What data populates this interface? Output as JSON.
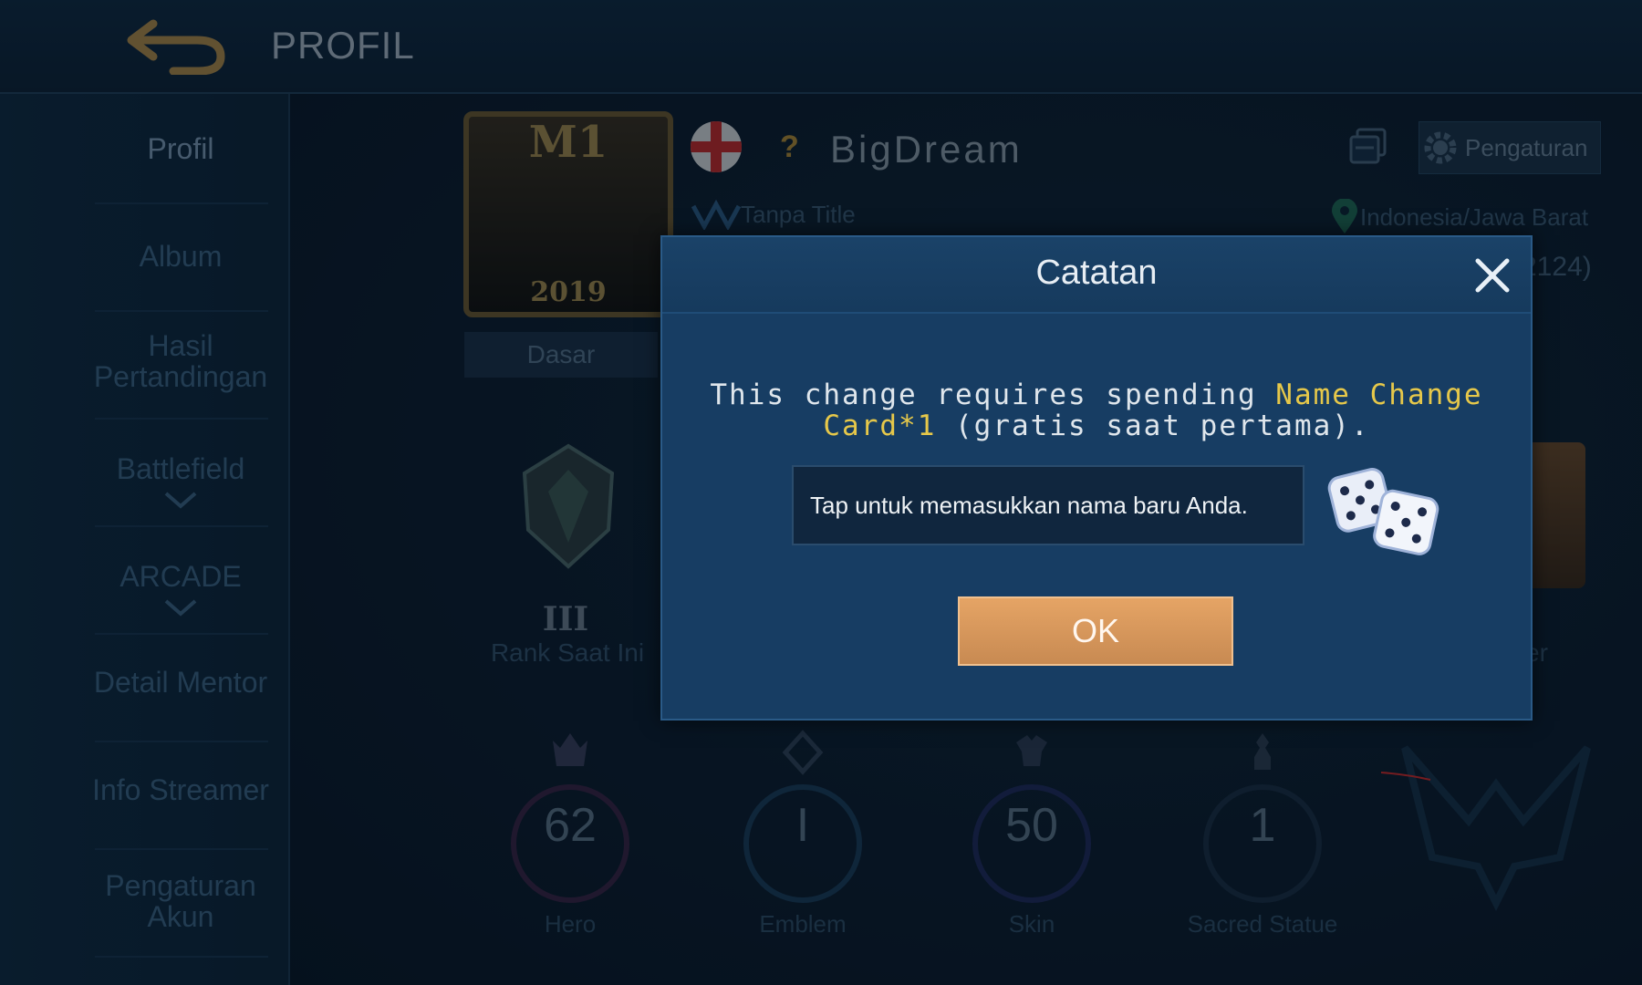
{
  "header": {
    "title": "PROFIL"
  },
  "sidebar": {
    "items": [
      {
        "label": "Profil"
      },
      {
        "label": "Album"
      },
      {
        "label": "Hasil Pertandingan"
      },
      {
        "label": "Battlefield"
      },
      {
        "label": "ARCADE"
      },
      {
        "label": "Detail Mentor"
      },
      {
        "label": "Info Streamer"
      },
      {
        "label": "Pengaturan Akun"
      }
    ]
  },
  "profile": {
    "avatar_frame_label": "M1",
    "avatar_frame_year": "2019",
    "avatar_tab": "Dasar",
    "verify_mark": "?",
    "username": "BigDream",
    "settings_label": "Pengaturan",
    "title": "Tanpa Title",
    "location": "Indonesia/Jawa Barat",
    "id_partial": "2124)",
    "rank_roman": "III",
    "rank_label": "Rank Saat Ini",
    "right_label_partial": "zer"
  },
  "stats": [
    {
      "value": "62",
      "label": "Hero"
    },
    {
      "value": "I",
      "label": "Emblem"
    },
    {
      "value": "50",
      "label": "Skin"
    },
    {
      "value": "1",
      "label": "Sacred Statue"
    }
  ],
  "dialog": {
    "title": "Catatan",
    "msg_part1": "This change requires spending ",
    "msg_highlight": "Name Change Card*1",
    "msg_part2": " (gratis saat pertama).",
    "input_placeholder": "Tap untuk memasukkan nama baru Anda.",
    "ok_label": "OK"
  },
  "colors": {
    "accent_gold": "#e6c84a",
    "ok_button": "#d99a5e",
    "dialog_bg": "#173d63"
  }
}
